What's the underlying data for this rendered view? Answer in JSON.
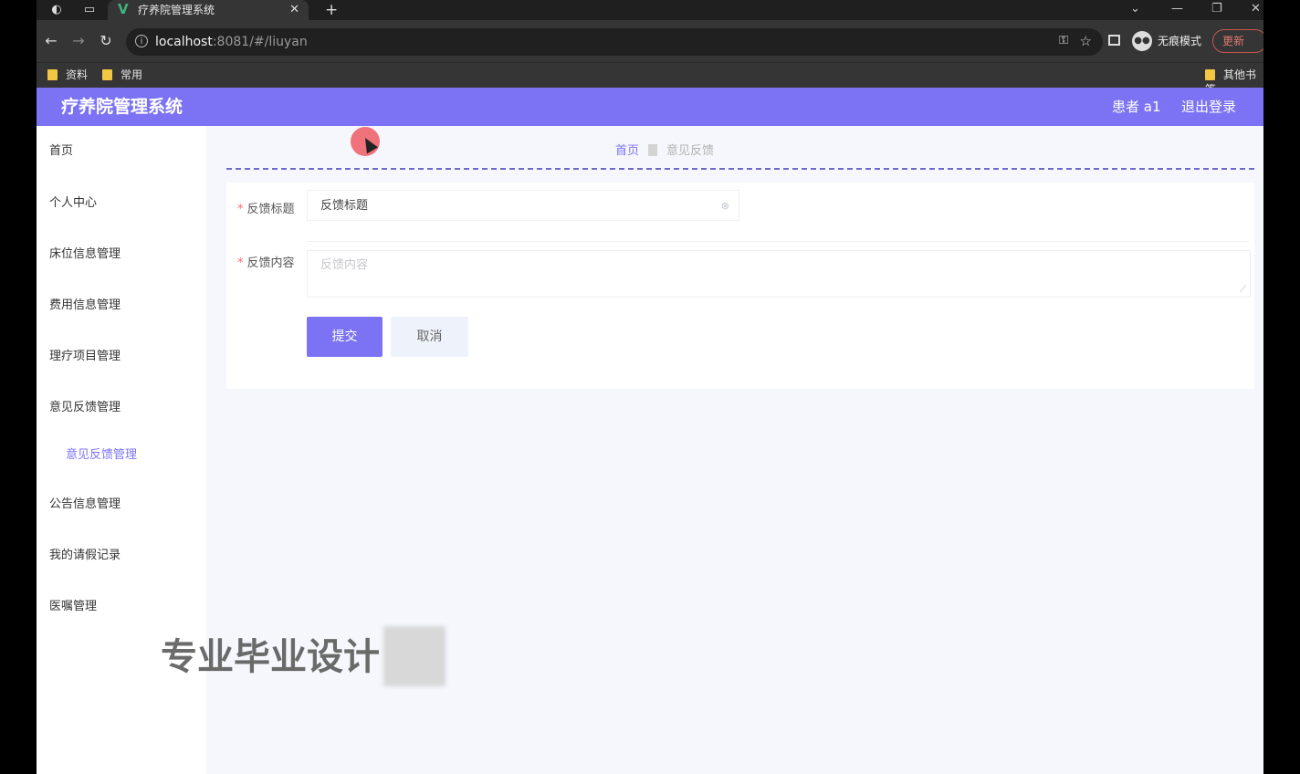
{
  "browser": {
    "tab_title": "疗养院管理系统",
    "url_host": "localhost",
    "url_rest": ":8081/#/liuyan",
    "incognito_label": "无痕模式",
    "update_label": "更新",
    "bookmarks": [
      "资料",
      "常用"
    ],
    "other_bookmarks": "其他书签"
  },
  "header": {
    "brand": "疗养院管理系统",
    "user": "患者 a1",
    "logout": "退出登录"
  },
  "sidebar": {
    "items": [
      "首页",
      "个人中心",
      "床位信息管理",
      "费用信息管理",
      "理疗项目管理",
      "意见反馈管理"
    ],
    "sub_item": "意见反馈管理",
    "items_after": [
      "公告信息管理",
      "我的请假记录",
      "医嘱管理"
    ]
  },
  "breadcrumb": {
    "home": "首页",
    "current": "意见反馈"
  },
  "form": {
    "title_label": "反馈标题",
    "title_value": "反馈标题",
    "content_label": "反馈内容",
    "content_placeholder": "反馈内容",
    "submit": "提交",
    "cancel": "取消"
  },
  "watermark": "专业毕业设计",
  "colors": {
    "accent": "#7b73f3",
    "required": "#f56c6c"
  }
}
